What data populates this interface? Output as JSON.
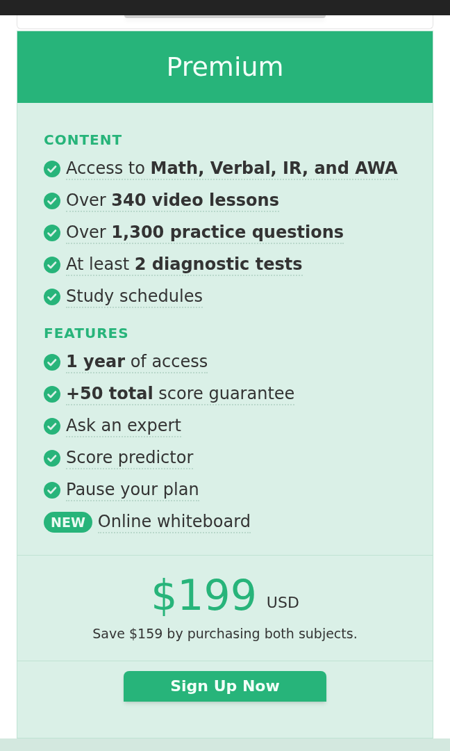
{
  "plan": {
    "title": "Premium"
  },
  "sections": [
    {
      "heading": "CONTENT",
      "items": [
        {
          "kind": "check",
          "text": "Access to **Math, Verbal, IR, and AWA**"
        },
        {
          "kind": "check",
          "text": "Over **340 video lessons**"
        },
        {
          "kind": "check",
          "text": "Over **1,300 practice questions**"
        },
        {
          "kind": "check",
          "text": "At least **2 diagnostic tests**"
        },
        {
          "kind": "check",
          "text": "Study schedules"
        }
      ]
    },
    {
      "heading": "FEATURES",
      "items": [
        {
          "kind": "check",
          "text": "**1 year** of access"
        },
        {
          "kind": "check",
          "text": "**+50 total** score guarantee"
        },
        {
          "kind": "check",
          "text": "Ask an expert"
        },
        {
          "kind": "check",
          "text": "Score predictor"
        },
        {
          "kind": "check",
          "text": "Pause your plan"
        },
        {
          "kind": "new",
          "badge": "NEW",
          "text": "Online whiteboard"
        }
      ]
    }
  ],
  "price": {
    "amount": "$199",
    "currency": "USD",
    "note": "Save $159 by purchasing both subjects."
  },
  "button": "Sign Up Now"
}
